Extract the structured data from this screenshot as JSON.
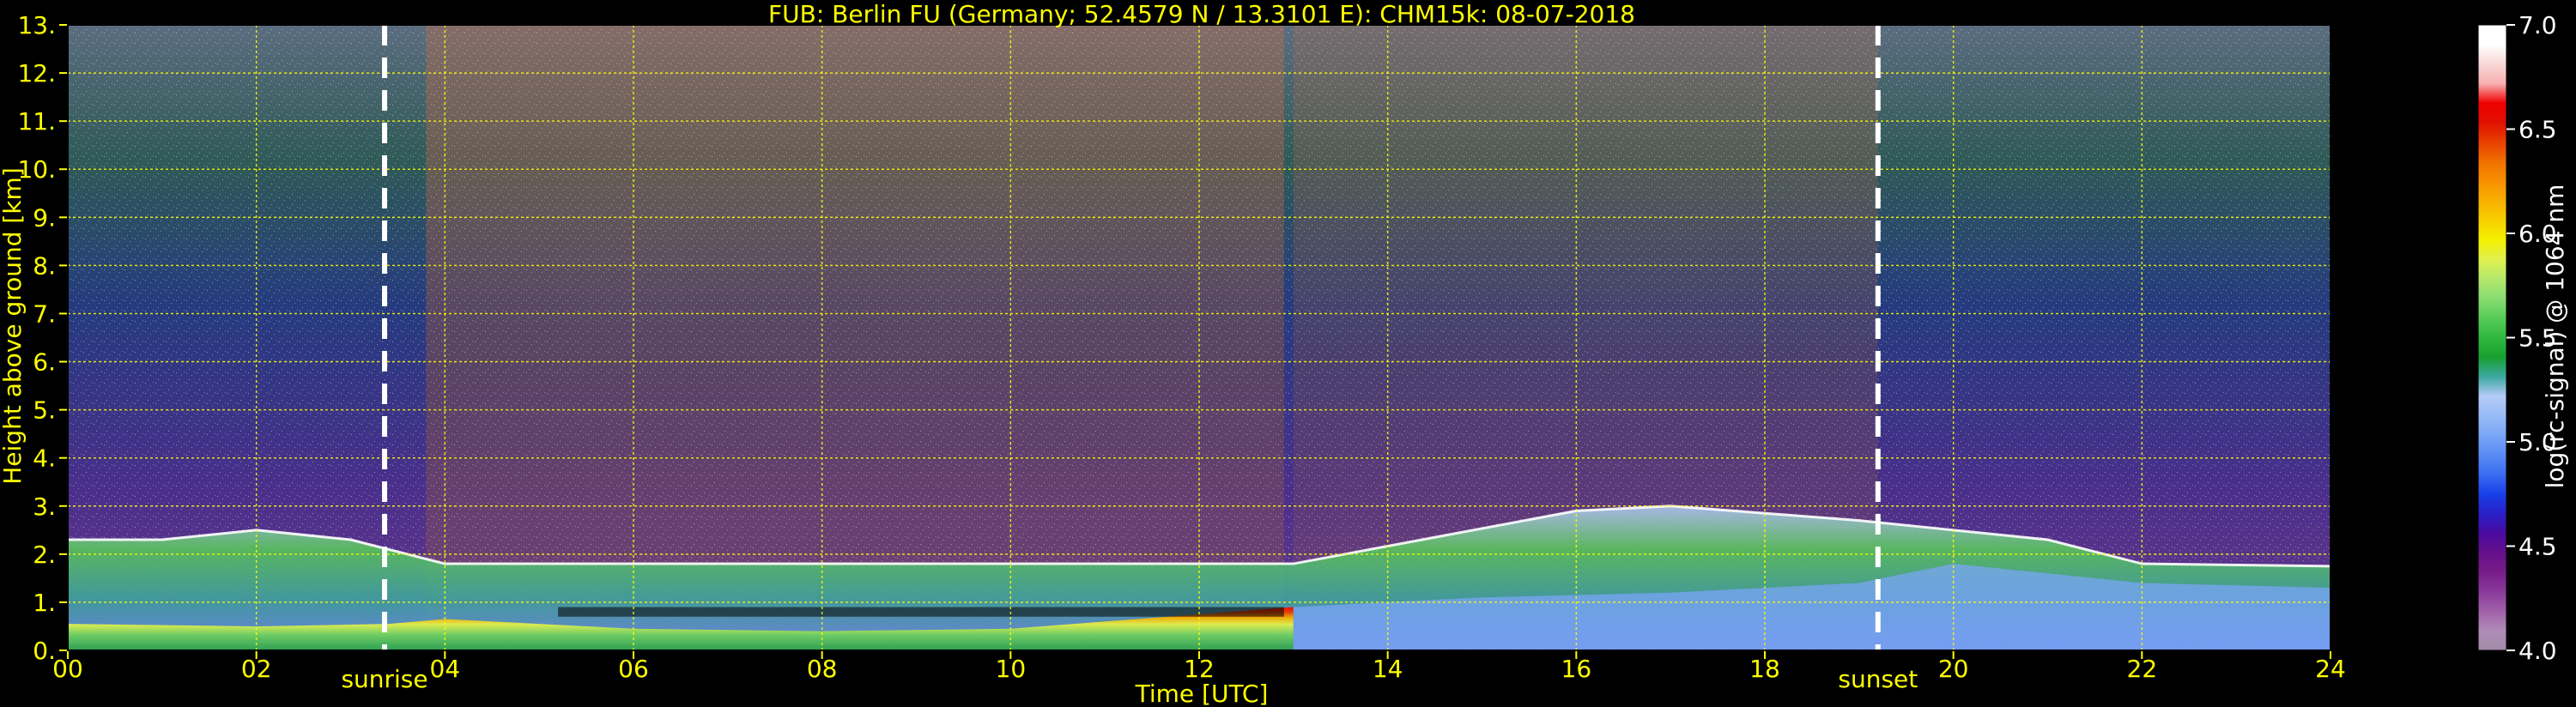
{
  "chart_data": {
    "type": "heatmap",
    "title": "FUB: Berlin FU (Germany; 52.4579 N / 13.3101 E):    CHM15k: 08-07-2018",
    "xlabel": "Time [UTC]",
    "ylabel": "Height above ground [km]",
    "colorbar_label": "log(rc-signal) @ 1064 nm",
    "xlim": [
      0,
      24
    ],
    "ylim": [
      0,
      13
    ],
    "clim": [
      4.0,
      7.0
    ],
    "x_ticks": [
      0,
      2,
      4,
      6,
      8,
      10,
      12,
      14,
      16,
      18,
      20,
      22,
      24
    ],
    "x_tick_labels": [
      "00",
      "02",
      "04",
      "06",
      "08",
      "10",
      "12",
      "14",
      "16",
      "18",
      "20",
      "22",
      "24"
    ],
    "y_ticks": [
      0,
      1,
      2,
      3,
      4,
      5,
      6,
      7,
      8,
      9,
      10,
      11,
      12,
      13
    ],
    "y_tick_labels": [
      "0.",
      "1.",
      "2.",
      "3.",
      "4.",
      "5.",
      "6.",
      "7.",
      "8.",
      "9.",
      "10.",
      "11.",
      "12.",
      "13."
    ],
    "colorbar_ticks": [
      4.0,
      4.5,
      5.0,
      5.5,
      6.0,
      6.5,
      7.0
    ],
    "colorbar_tick_labels": [
      "4.0",
      "4.5",
      "5.0",
      "5.5",
      "6.0",
      "6.5",
      "7.0"
    ],
    "colorbar_colors": [
      "#a18ca8",
      "#b08cb8",
      "#a060a8",
      "#8a3a9a",
      "#781c8a",
      "#64108a",
      "#4a0aa0",
      "#2820c8",
      "#1840e8",
      "#3a6cf0",
      "#5a8cf4",
      "#7aa6f6",
      "#98bcf6",
      "#b4ccf8",
      "#3ca8a0",
      "#18a030",
      "#30b840",
      "#58cc58",
      "#88dc70",
      "#b4e86c",
      "#e0f050",
      "#f4f000",
      "#f8d000",
      "#f8b000",
      "#f89000",
      "#f07000",
      "#e84000",
      "#e01000",
      "#f00000",
      "#f8b0b0",
      "#f8d8d8",
      "#ffffff",
      "#ffffff"
    ],
    "grid": true,
    "grid_color": "#ffff00",
    "time_markers": [
      {
        "label": "sunrise",
        "x": 3.36
      },
      {
        "label": "sunset",
        "x": 19.2
      }
    ],
    "layers": {
      "boundary_layer_top_km": [
        [
          0,
          0.55
        ],
        [
          2,
          0.5
        ],
        [
          3.4,
          0.55
        ],
        [
          4,
          0.65
        ],
        [
          5,
          0.55
        ],
        [
          6,
          0.45
        ],
        [
          8,
          0.4
        ],
        [
          10,
          0.45
        ],
        [
          11,
          0.6
        ],
        [
          12,
          0.75
        ],
        [
          13,
          0.9
        ]
      ],
      "cloud_top_height_km": [
        [
          0,
          2.3
        ],
        [
          1,
          2.3
        ],
        [
          2,
          2.5
        ],
        [
          3,
          2.3
        ],
        [
          4,
          1.8
        ],
        [
          13,
          1.8
        ],
        [
          16,
          2.9
        ],
        [
          17,
          3.0
        ],
        [
          19,
          2.7
        ],
        [
          20,
          2.5
        ],
        [
          21,
          2.3
        ],
        [
          22,
          1.8
        ],
        [
          24,
          1.75
        ]
      ]
    }
  }
}
